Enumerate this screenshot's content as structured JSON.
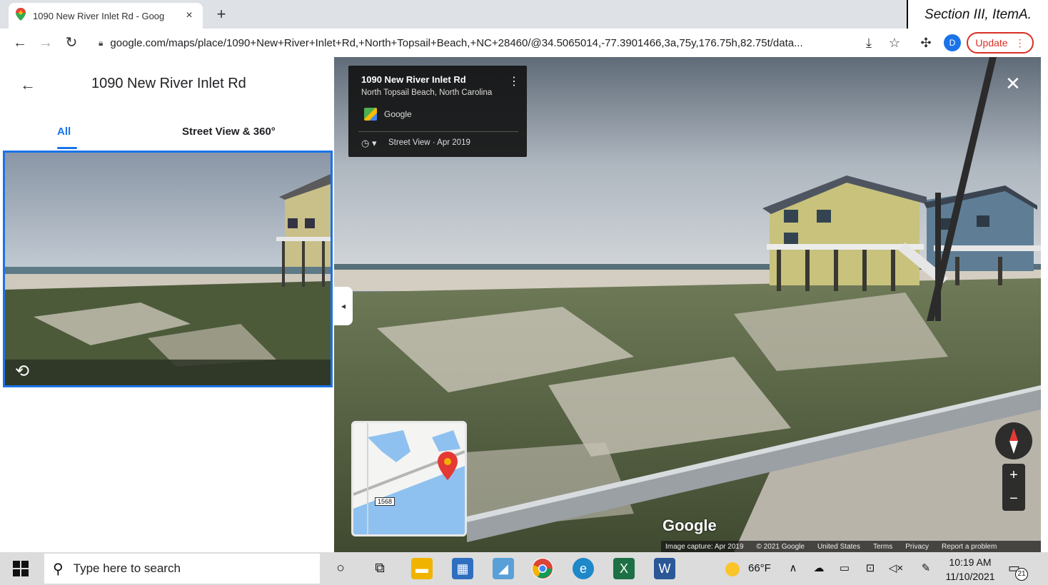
{
  "browser": {
    "tab_title": "1090 New River Inlet Rd - Goog",
    "tab_close": "×",
    "new_tab": "+",
    "url": "google.com/maps/place/1090+New+River+Inlet+Rd,+North+Topsail+Beach,+NC+28460/@34.5065014,-77.3901466,3a,75y,176.75h,82.75t/data...",
    "avatar_letter": "D",
    "update_label": "Update"
  },
  "stamp": {
    "text": "Section III, ItemA."
  },
  "panel": {
    "title": "1090 New River Inlet Rd",
    "tabs": [
      {
        "label": "All",
        "active": true
      },
      {
        "label": "Street View & 360°",
        "active": false
      }
    ]
  },
  "streetview": {
    "card": {
      "title": "1090 New River Inlet Rd",
      "subtitle": "North Topsail Beach, North Carolina",
      "provider": "Google",
      "date": "Street View · Apr 2019"
    },
    "minimap_route": "1568",
    "watermark": "Google",
    "footer": {
      "capture": "Image capture: Apr 2019",
      "copyright": "© 2021 Google",
      "country": "United States",
      "terms": "Terms",
      "privacy": "Privacy",
      "report": "Report a problem"
    },
    "zoom_in": "+",
    "zoom_out": "−"
  },
  "taskbar": {
    "search_placeholder": "Type here to search",
    "temperature": "66°F",
    "time": "10:19 AM",
    "date": "11/10/2021",
    "notifications": "21"
  },
  "colors": {
    "accent": "#1a73e8",
    "update_red": "#d93025"
  }
}
